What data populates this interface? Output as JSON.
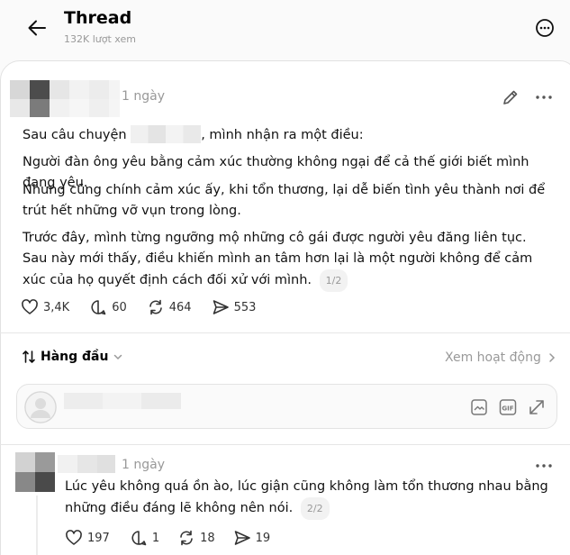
{
  "header": {
    "title": "Thread",
    "views": "132K lượt xem"
  },
  "post": {
    "time": "1 ngày",
    "paragraphs": [
      {
        "before": "Sau câu chuyện ",
        "after": ", mình nhận ra một điều:"
      },
      {
        "text": "Người đàn ông yêu bằng cảm xúc thường không ngại để cả thế giới biết mình đang yêu."
      },
      {
        "text": "Nhưng cũng chính cảm xúc ấy, khi tổn thương, lại dễ biến tình yêu thành nơi để trút hết những vỡ vụn trong lòng."
      },
      {
        "text": "Trước đây, mình từng ngưỡng mộ những cô gái được người yêu đăng liên tục. Sau này mới thấy, điều khiến mình an tâm hơn lại là một người không để cảm xúc của họ quyết định cách đối xử với mình."
      }
    ],
    "page_indicator": "1/2",
    "stats": {
      "likes": "3,4K",
      "comments": "60",
      "reposts": "464",
      "shares": "553"
    }
  },
  "sort": {
    "label": "Hàng đầu"
  },
  "activity": {
    "label": "Xem hoạt động"
  },
  "reply_box": {
    "icons": [
      "sticker-icon",
      "gif-icon",
      "expand-icon"
    ]
  },
  "comment": {
    "time": "1 ngày",
    "text": "Lúc yêu không quá ồn ào, lúc giận cũng không làm tổn thương nhau bằng những điều đáng lẽ không nên nói.",
    "page_indicator": "2/2",
    "stats": {
      "likes": "197",
      "comments": "1",
      "reposts": "18",
      "shares": "19"
    }
  },
  "colors": {
    "muted": "#999999",
    "border": "#e2e2e2",
    "text": "#111111"
  }
}
